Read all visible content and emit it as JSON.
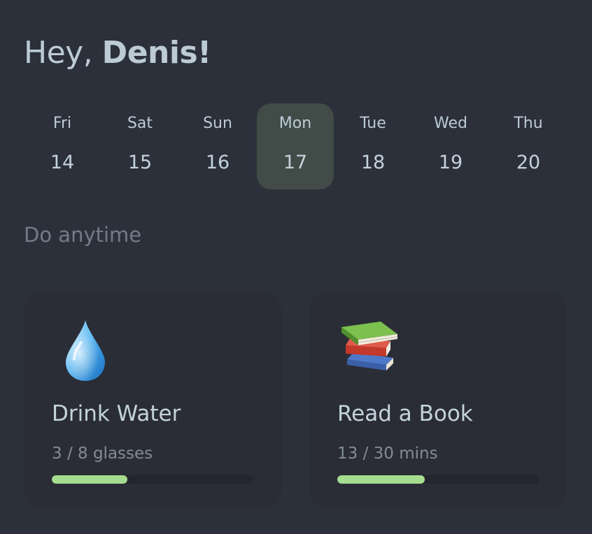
{
  "greeting": {
    "prefix": "Hey, ",
    "name": "Denis!"
  },
  "week": {
    "selected_index": 3,
    "days": [
      {
        "dow": "Fri",
        "num": "14"
      },
      {
        "dow": "Sat",
        "num": "15"
      },
      {
        "dow": "Sun",
        "num": "16"
      },
      {
        "dow": "Mon",
        "num": "17"
      },
      {
        "dow": "Tue",
        "num": "18"
      },
      {
        "dow": "Wed",
        "num": "19"
      },
      {
        "dow": "Thu",
        "num": "20"
      }
    ]
  },
  "section": {
    "title": "Do anytime"
  },
  "habits": [
    {
      "icon": "water-drop-icon",
      "title": "Drink Water",
      "progress_text": "3 / 8 glasses",
      "progress_fraction": 0.375
    },
    {
      "icon": "books-icon",
      "title": "Read a Book",
      "progress_text": "13 / 30 mins",
      "progress_fraction": 0.4333
    }
  ],
  "colors": {
    "background": "#2c303b",
    "card": "#2a2d36",
    "selected_day": "#414b47",
    "progress_fill": "#a6dc8f",
    "progress_track": "#23262e"
  }
}
